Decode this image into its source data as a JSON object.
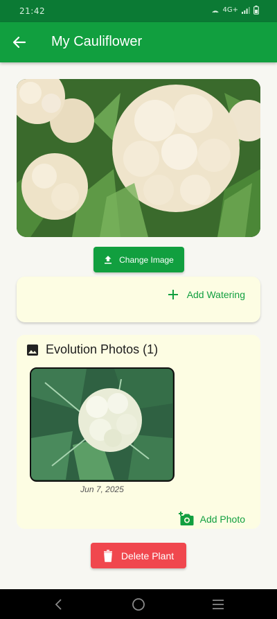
{
  "status_bar": {
    "time": "21:42",
    "network": "4G+"
  },
  "app_bar": {
    "title": "My Cauliflower"
  },
  "hero_image": {
    "icon": "cauliflower-photo"
  },
  "change_image_button": {
    "label": "Change Image",
    "icon": "upload-icon"
  },
  "watering_card": {
    "add_label": "Add Watering",
    "icon": "plus-icon"
  },
  "evolution": {
    "title": "Evolution Photos (1)",
    "icon": "image-icon",
    "photos": [
      {
        "date": "Jun 7, 2025"
      }
    ],
    "add_label": "Add Photo",
    "add_icon": "add-photo-icon"
  },
  "delete_button": {
    "label": "Delete Plant",
    "icon": "trash-icon"
  },
  "colors": {
    "primary": "#119f3f",
    "status": "#0b7a34",
    "card": "#fdfde3",
    "danger": "#f0474e"
  }
}
